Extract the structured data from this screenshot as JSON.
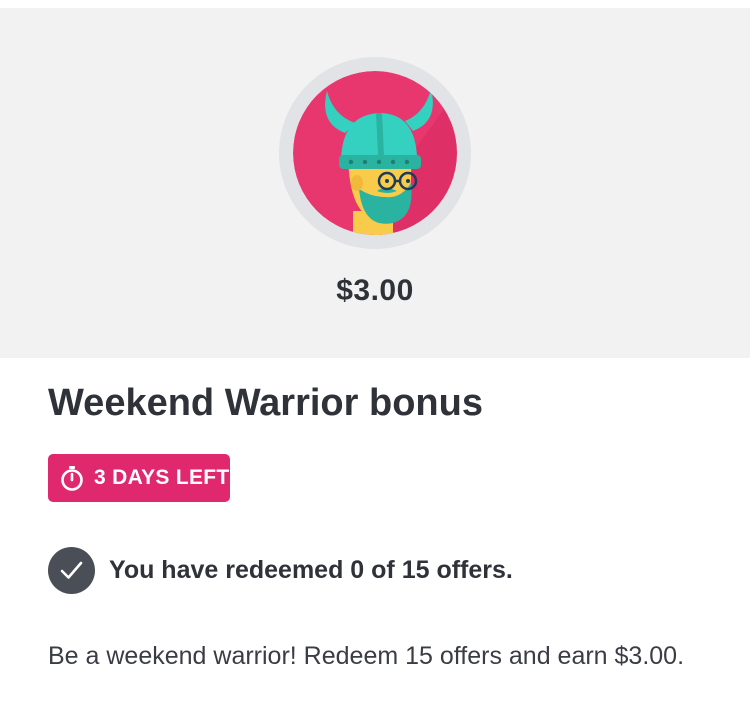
{
  "hero": {
    "badge_icon": "viking-warrior-avatar",
    "amount": "$3.00"
  },
  "offer": {
    "title": "Weekend Warrior bonus",
    "timer_icon": "stopwatch-icon",
    "time_left": "3 DAYS LEFT",
    "progress_icon": "check-circle-icon",
    "progress_text": "You have redeemed 0 of 15 offers.",
    "description": "Be a weekend warrior! Redeem 15 offers and earn $3.00."
  },
  "colors": {
    "accent": "#e0286e",
    "hero_bg": "#f2f2f2",
    "check_bg": "#4a4e57",
    "text": "#2f3238"
  }
}
